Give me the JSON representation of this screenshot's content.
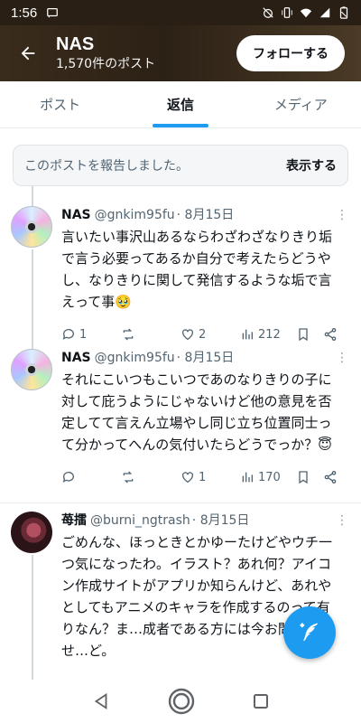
{
  "status_bar": {
    "time": "1:56"
  },
  "header": {
    "title": "NAS",
    "subtitle": "1,570件のポスト",
    "follow_label": "フォローする"
  },
  "tabs": [
    {
      "label": "ポスト"
    },
    {
      "label": "返信"
    },
    {
      "label": "メディア"
    }
  ],
  "active_tab": "返信",
  "report": {
    "text": "このポストを報告しました。",
    "show_label": "表示する"
  },
  "tweets": [
    {
      "name": "NAS",
      "handle": "@gnkim95fu",
      "date": "· 8月15日",
      "text": "言いたい事沢山あるならわざわざなりきり垢で言う必要ってあるか自分で考えたらどうやし、なりきりに関して発信するような垢で言えって事🥹",
      "replies": "1",
      "retweets": "",
      "likes": "2",
      "views": "212"
    },
    {
      "name": "NAS",
      "handle": "@gnkim95fu",
      "date": "· 8月15日",
      "text": "それにこいつもこいつであのなりきりの子に対して庇うようにじゃないけど他の意見を否定してて言えん立場やし同じ立ち位置同士って分かってへんの気付いたらどうでっか？😇",
      "replies": "",
      "retweets": "",
      "likes": "1",
      "views": "170"
    },
    {
      "name": "苺擂",
      "handle": "@burni_ngtrash",
      "date": "· 8月15日",
      "text": "ごめんな、ほっときとかゆーたけどやウチ一つ気になったわ。イラスト？あれ何？アイコン作成サイトがアプリか知らんけど、あれやとしてもアニメのキャラを作成するのって有りなん？ま…成者である方には今お問い合わせ…ど。"
    }
  ],
  "more_glyph": "⋮",
  "colors": {
    "accent": "#1d9bf0",
    "header_bg": "#2c2116"
  }
}
